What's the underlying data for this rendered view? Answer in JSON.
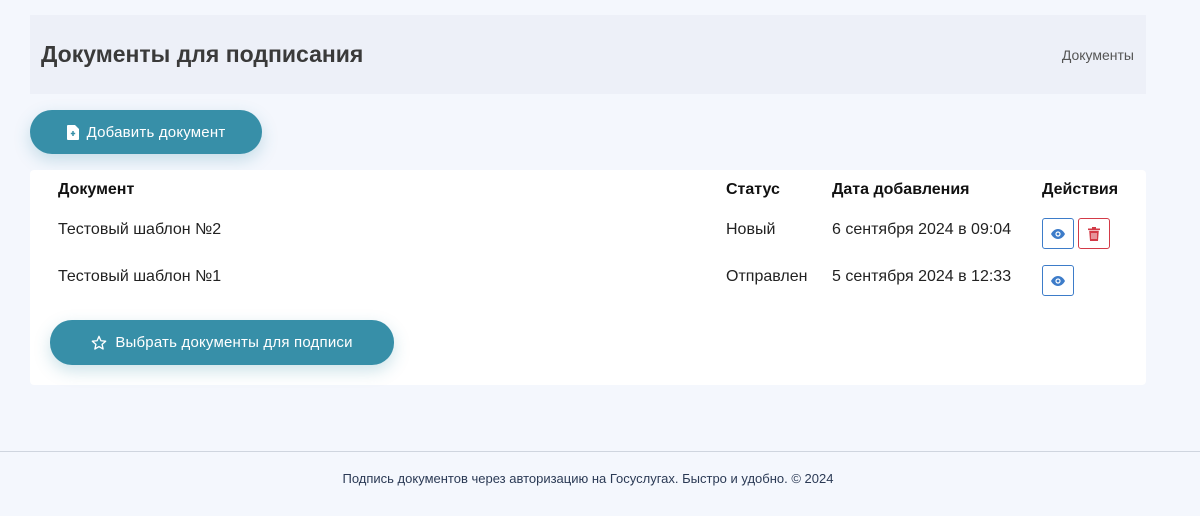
{
  "header": {
    "title": "Документы для подписания",
    "breadcrumb": "Документы"
  },
  "toolbar": {
    "add_label": "Добавить документ",
    "add_icon": "file-plus-icon"
  },
  "table": {
    "columns": [
      "Документ",
      "Статус",
      "Дата добавления",
      "Действия"
    ],
    "rows": [
      {
        "document": "Тестовый шаблон №2",
        "status": "Новый",
        "date": "6 сентября 2024 в 09:04",
        "actions": [
          "view",
          "delete"
        ]
      },
      {
        "document": "Тестовый шаблон №1",
        "status": "Отправлен",
        "date": "5 сентября 2024 в 12:33",
        "actions": [
          "view"
        ]
      }
    ]
  },
  "select_button": {
    "label": "Выбрать документы для подписи",
    "icon": "star-icon"
  },
  "footer": {
    "text": "Подпись документов через авторизацию на Госуслугах. Быстро и удобно. © 2024"
  },
  "colors": {
    "accent": "#378fa8",
    "view": "#3d7cc9",
    "delete": "#d33a47",
    "page_bg": "#f4f7fd",
    "header_bg": "#edf0f8"
  }
}
